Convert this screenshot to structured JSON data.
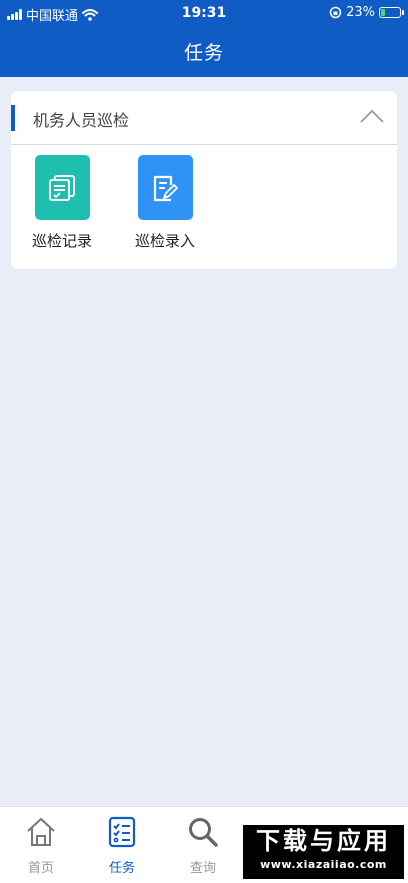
{
  "status_bar": {
    "carrier": "中国联通",
    "time": "19:31",
    "battery_percent": "23%",
    "battery_level": 0.23,
    "signal_icon": "signal-bars-icon",
    "wifi_icon": "wifi-icon",
    "lock_icon": "orientation-lock-icon"
  },
  "header": {
    "title": "任务"
  },
  "section": {
    "title": "机务人员巡检",
    "collapse_icon": "chevron-up-icon",
    "items": [
      {
        "label": "巡检记录",
        "icon": "records-icon",
        "color": "#1fbfb0"
      },
      {
        "label": "巡检录入",
        "icon": "edit-document-icon",
        "color": "#2f93f5"
      }
    ]
  },
  "tabbar": {
    "tabs": [
      {
        "label": "首页",
        "icon": "home-icon",
        "active": false
      },
      {
        "label": "任务",
        "icon": "task-list-icon",
        "active": true
      },
      {
        "label": "查询",
        "icon": "search-icon",
        "active": false
      }
    ]
  },
  "watermark": {
    "main": "下载与应用",
    "sub": "www.xiazaiiao.com"
  },
  "colors": {
    "primary": "#0f5cc4",
    "background": "#e9edf8",
    "inactive_tab": "#999999"
  }
}
